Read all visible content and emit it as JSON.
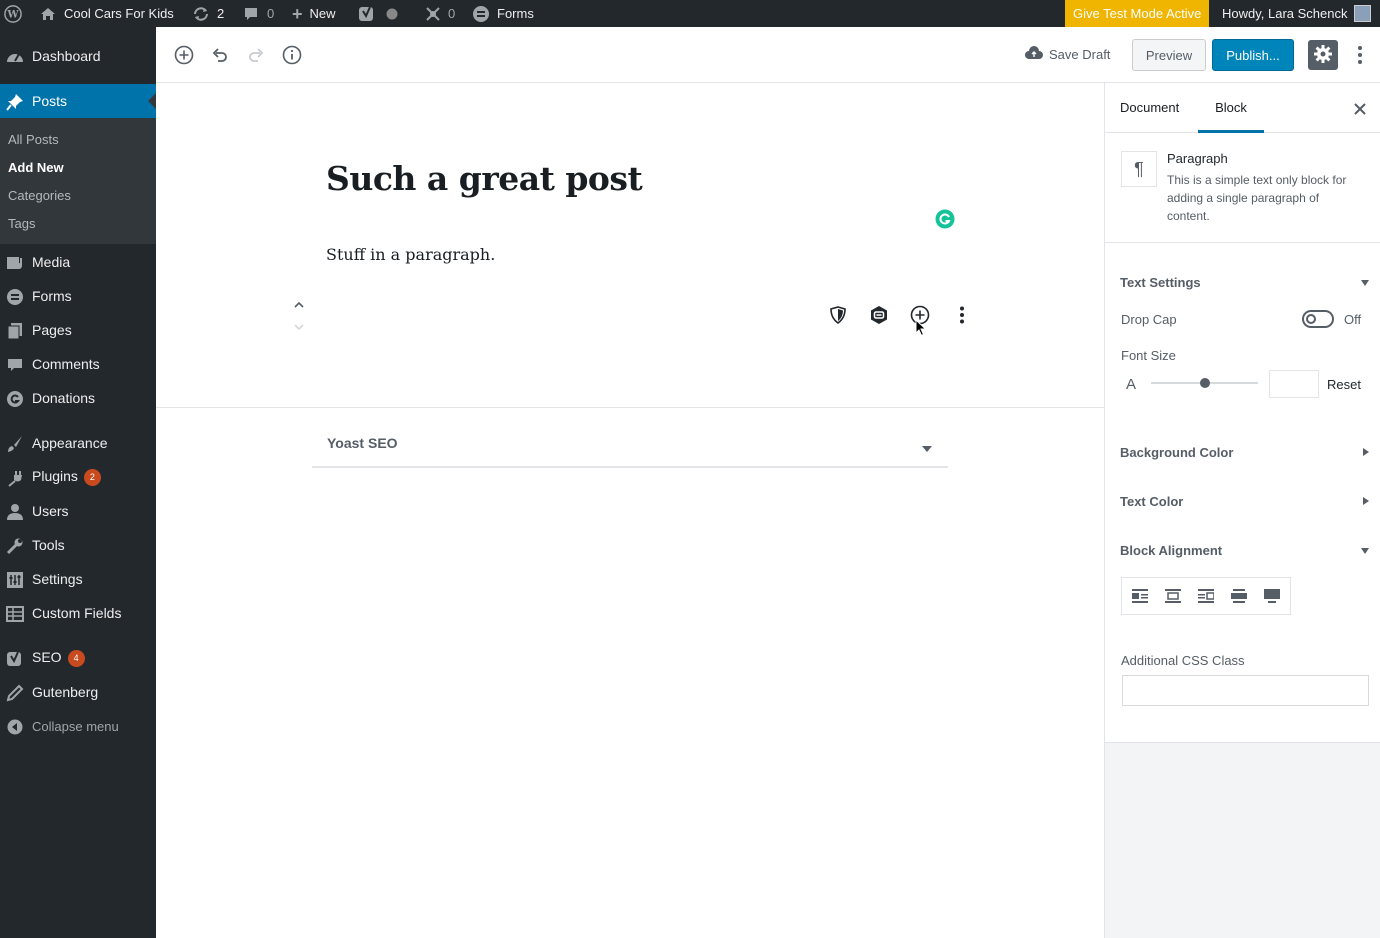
{
  "adminbar": {
    "site_name": "Cool Cars For Kids",
    "updates_count": "2",
    "comments_count": "0",
    "new_label": "New",
    "plugin_count": "0",
    "forms_label": "Forms",
    "give_test_mode": "Give Test Mode Active",
    "howdy": "Howdy, Lara Schenck"
  },
  "menu": {
    "dashboard": "Dashboard",
    "posts": "Posts",
    "submenu": [
      "All Posts",
      "Add New",
      "Categories",
      "Tags"
    ],
    "media": "Media",
    "forms": "Forms",
    "pages": "Pages",
    "comments": "Comments",
    "donations": "Donations",
    "appearance": "Appearance",
    "plugins": "Plugins",
    "plugins_badge": "2",
    "users": "Users",
    "tools": "Tools",
    "settings": "Settings",
    "custom_fields": "Custom Fields",
    "seo": "SEO",
    "seo_badge": "4",
    "gutenberg": "Gutenberg",
    "collapse": "Collapse menu"
  },
  "toolbar": {
    "save_draft": "Save Draft",
    "preview": "Preview",
    "publish": "Publish..."
  },
  "editor": {
    "title": "Such a great post",
    "paragraph": "Stuff in a paragraph.",
    "yoast_label": "Yoast SEO"
  },
  "sidebar": {
    "tab_document": "Document",
    "tab_block": "Block",
    "block_name": "Paragraph",
    "block_description": "This is a simple text only block for adding a single paragraph of content.",
    "text_settings": "Text Settings",
    "drop_cap": "Drop Cap",
    "drop_cap_state": "Off",
    "font_size": "Font Size",
    "font_size_icon_letter": "A",
    "reset": "Reset",
    "background_color": "Background Color",
    "text_color": "Text Color",
    "block_alignment": "Block Alignment",
    "additional_css": "Additional CSS Class",
    "font_size_slider_level": 0.5
  },
  "colors": {
    "admin_dark": "#23282d",
    "accent_blue": "#0073aa",
    "give_yellow": "#f0b500",
    "badge_red": "#ca4a1f",
    "grammarly_green": "#15c39a"
  }
}
